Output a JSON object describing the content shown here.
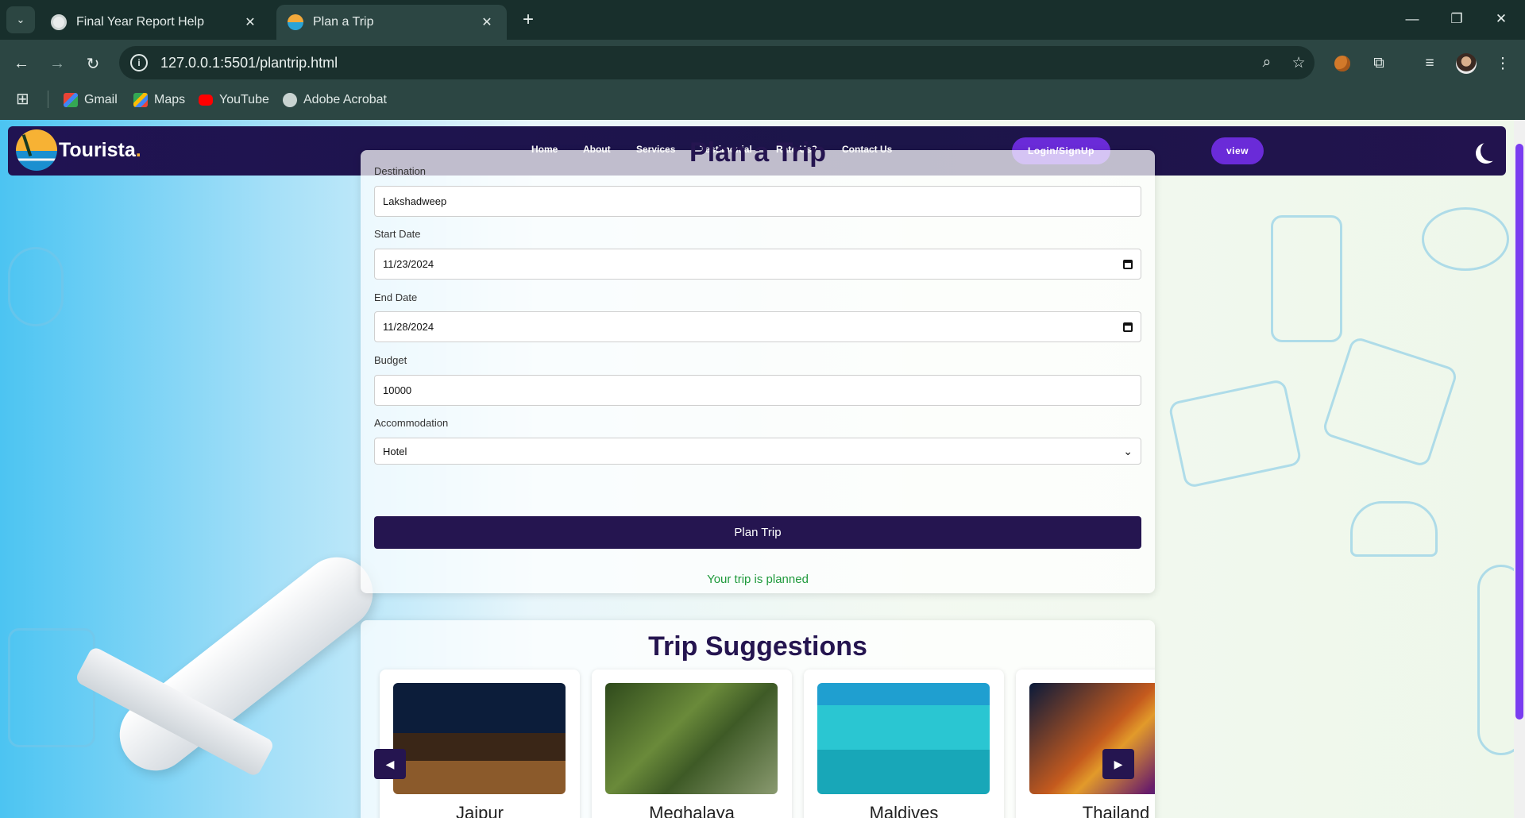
{
  "browser": {
    "tabs": [
      {
        "title": "Final Year Report Help",
        "icon": "chatgpt-icon"
      },
      {
        "title": "Plan a Trip",
        "icon": "tourista-favicon"
      }
    ],
    "url": "127.0.0.1:5501/plantrip.html",
    "bookmarks": [
      {
        "label": "Gmail",
        "icon": "gmail-icon",
        "color": "#ea4335"
      },
      {
        "label": "Maps",
        "icon": "maps-icon",
        "color": "#34a853"
      },
      {
        "label": "YouTube",
        "icon": "youtube-icon",
        "color": "#ff0000"
      },
      {
        "label": "Adobe Acrobat",
        "icon": "globe-icon",
        "color": "#c9d3d1"
      }
    ]
  },
  "site": {
    "brand": "Tourista",
    "brand_dot": ".",
    "nav": [
      "Home",
      "About",
      "Services",
      "Testimonial",
      "Rate Us?",
      "Contact Us"
    ],
    "login_label": "Login/SignUp",
    "view_label": "view",
    "accent": "#6a2bd8",
    "navy": "#251550"
  },
  "form": {
    "title": "Plan a Trip",
    "fields": [
      {
        "label": "Destination",
        "value": "Lakshadweep",
        "type": "text"
      },
      {
        "label": "Start Date",
        "value": "11/23/2024",
        "type": "date"
      },
      {
        "label": "End Date",
        "value": "11/28/2024",
        "type": "date"
      },
      {
        "label": "Budget",
        "value": "10000",
        "type": "text"
      },
      {
        "label": "Accommodation",
        "value": "Hotel",
        "type": "select"
      }
    ],
    "submit_label": "Plan Trip",
    "status": "Your trip is planned",
    "status_color": "#1f9a3c"
  },
  "suggestions": {
    "title": "Trip Suggestions",
    "items": [
      "Jaipur",
      "Meghalaya",
      "Maldives",
      "Thailand"
    ],
    "prev_label": "◀",
    "next_label": "▶"
  }
}
